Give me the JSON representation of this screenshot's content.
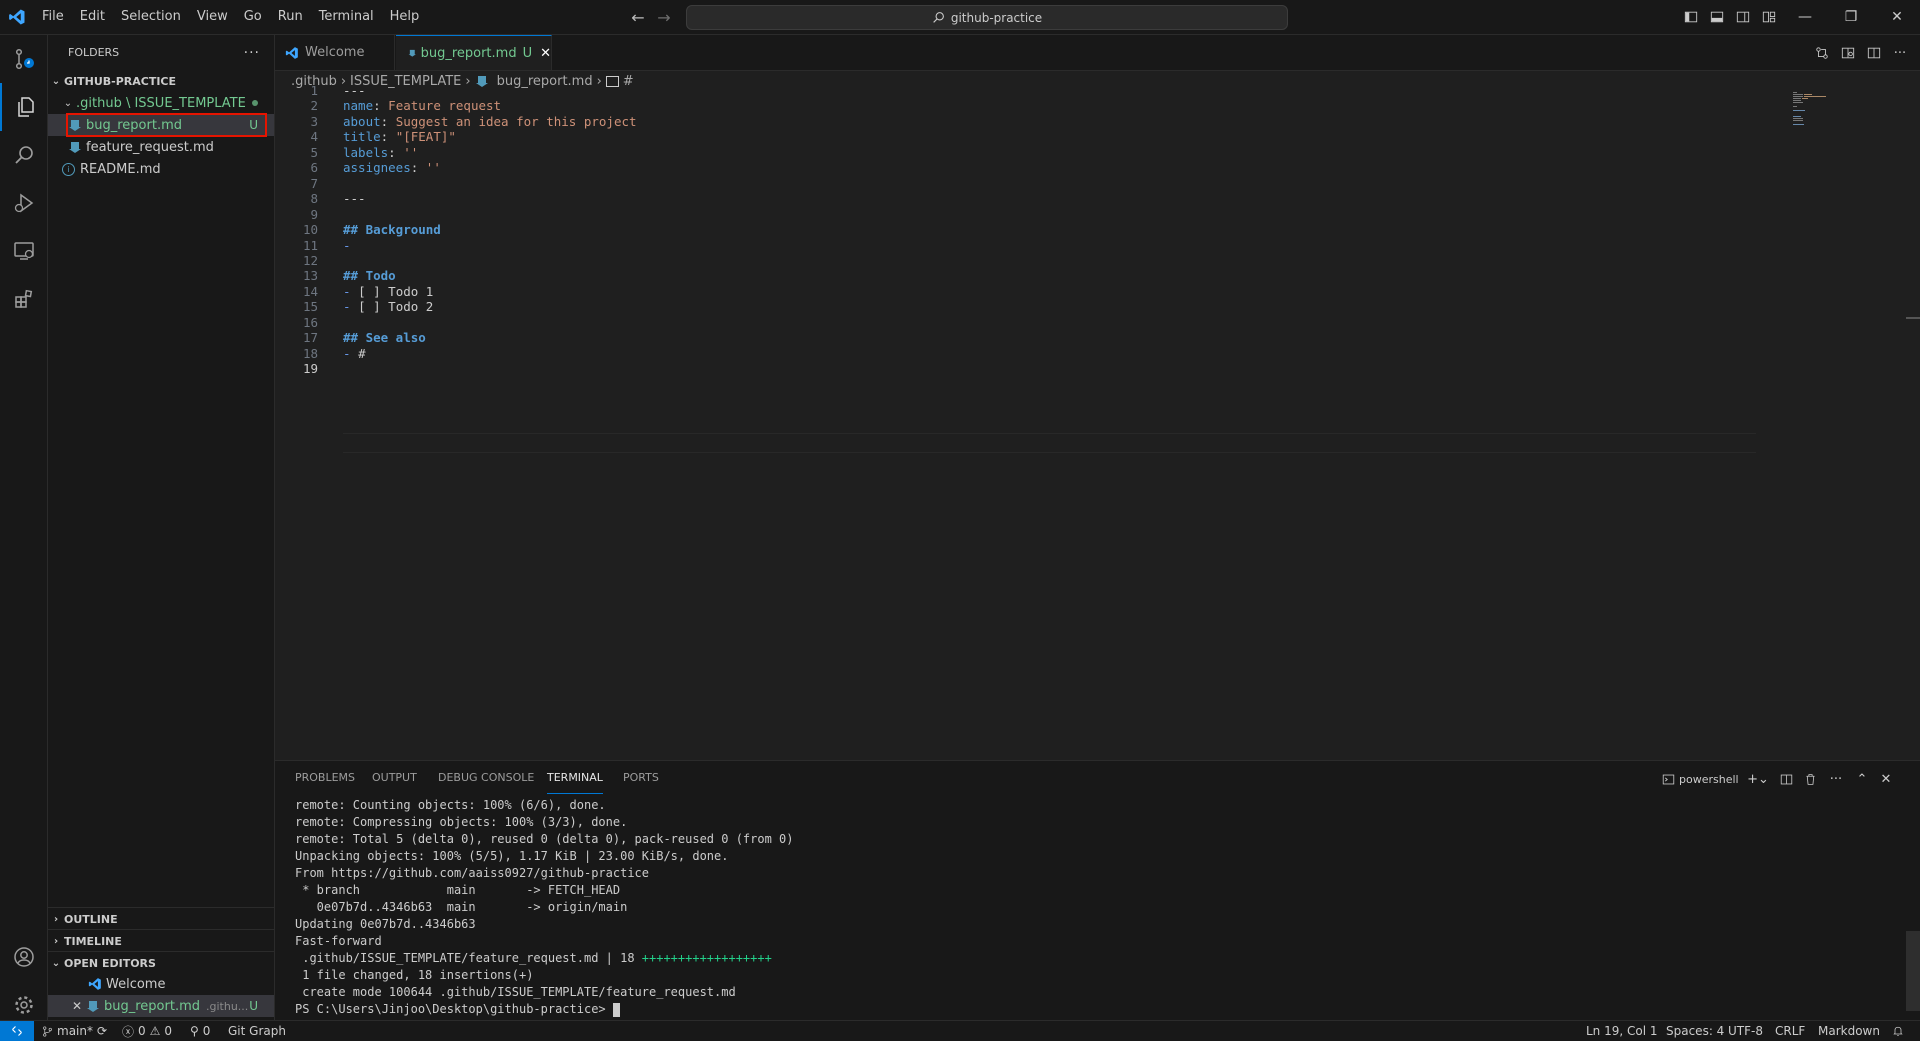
{
  "menu": [
    "File",
    "Edit",
    "Selection",
    "View",
    "Go",
    "Run",
    "Terminal",
    "Help"
  ],
  "search": {
    "text": "github-practice"
  },
  "explorer": {
    "header": "FOLDERS",
    "root": "GITHUB-PRACTICE",
    "folder": ".github \\ ISSUE_TEMPLATE",
    "files": [
      {
        "name": "bug_report.md",
        "status": "U"
      },
      {
        "name": "feature_request.md",
        "status": ""
      }
    ],
    "readme": "README.md",
    "sections": {
      "outline": "OUTLINE",
      "timeline": "TIMELINE",
      "open_editors": "OPEN EDITORS"
    },
    "open_editors": [
      {
        "name": "Welcome",
        "path": ""
      },
      {
        "name": "bug_report.md",
        "path": ".githu...",
        "status": "U"
      }
    ]
  },
  "tabs": [
    {
      "label": "Welcome",
      "status": ""
    },
    {
      "label": "bug_report.md",
      "status": "U"
    }
  ],
  "breadcrumb": [
    ".github",
    "ISSUE_TEMPLATE",
    "bug_report.md",
    "#"
  ],
  "editor": {
    "current_line": 19,
    "lines": [
      [
        {
          "c": "t",
          "v": "---"
        }
      ],
      [
        {
          "c": "k",
          "v": "name"
        },
        {
          "c": "t",
          "v": ": "
        },
        {
          "c": "s",
          "v": "Feature request"
        }
      ],
      [
        {
          "c": "k",
          "v": "about"
        },
        {
          "c": "t",
          "v": ": "
        },
        {
          "c": "s",
          "v": "Suggest an idea for this project"
        }
      ],
      [
        {
          "c": "k",
          "v": "title"
        },
        {
          "c": "t",
          "v": ": "
        },
        {
          "c": "s",
          "v": "\"[FEAT]\""
        }
      ],
      [
        {
          "c": "k",
          "v": "labels"
        },
        {
          "c": "t",
          "v": ": "
        },
        {
          "c": "s",
          "v": "''"
        }
      ],
      [
        {
          "c": "k",
          "v": "assignees"
        },
        {
          "c": "t",
          "v": ": "
        },
        {
          "c": "s",
          "v": "''"
        }
      ],
      [],
      [
        {
          "c": "t",
          "v": "---"
        }
      ],
      [],
      [
        {
          "c": "h",
          "v": "## Background"
        }
      ],
      [
        {
          "c": "p",
          "v": "- "
        }
      ],
      [],
      [
        {
          "c": "h",
          "v": "## Todo"
        }
      ],
      [
        {
          "c": "p",
          "v": "- "
        },
        {
          "c": "t",
          "v": "[ ] Todo 1"
        }
      ],
      [
        {
          "c": "p",
          "v": "- "
        },
        {
          "c": "t",
          "v": "[ ] Todo 2"
        }
      ],
      [],
      [
        {
          "c": "h",
          "v": "## See also"
        }
      ],
      [
        {
          "c": "p",
          "v": "- "
        },
        {
          "c": "t",
          "v": "#"
        }
      ],
      []
    ]
  },
  "panel": {
    "tabs": [
      "PROBLEMS",
      "OUTPUT",
      "DEBUG CONSOLE",
      "TERMINAL",
      "PORTS"
    ],
    "active_tab": "TERMINAL",
    "shell": "powershell",
    "terminal_lines": [
      "remote: Counting objects: 100% (6/6), done.",
      "remote: Compressing objects: 100% (3/3), done.",
      "remote: Total 5 (delta 0), reused 0 (delta 0), pack-reused 0 (from 0)",
      "Unpacking objects: 100% (5/5), 1.17 KiB | 23.00 KiB/s, done.",
      "From https://github.com/aaiss0927/github-practice",
      " * branch            main       -> FETCH_HEAD",
      "   0e07b7d..4346b63  main       -> origin/main",
      "Updating 0e07b7d..4346b63",
      "Fast-forward",
      " .github/ISSUE_TEMPLATE/feature_request.md | 18 ",
      " 1 file changed, 18 insertions(+)",
      " create mode 100644 .github/ISSUE_TEMPLATE/feature_request.md",
      "PS C:\\Users\\Jinjoo\\Desktop\\github-practice> "
    ],
    "plus_marks": "++++++++++++++++++"
  },
  "status": {
    "branch": "main*",
    "errors": "0",
    "warnings": "0",
    "ports": "0",
    "git_graph": "Git Graph",
    "position": "Ln 19, Col 1",
    "spaces": "Spaces: 4",
    "encoding": "UTF-8",
    "eol": "CRLF",
    "language": "Markdown"
  },
  "colors": {
    "accent": "#0078d4",
    "untracked": "#73c991",
    "highlight": "#e51400"
  }
}
